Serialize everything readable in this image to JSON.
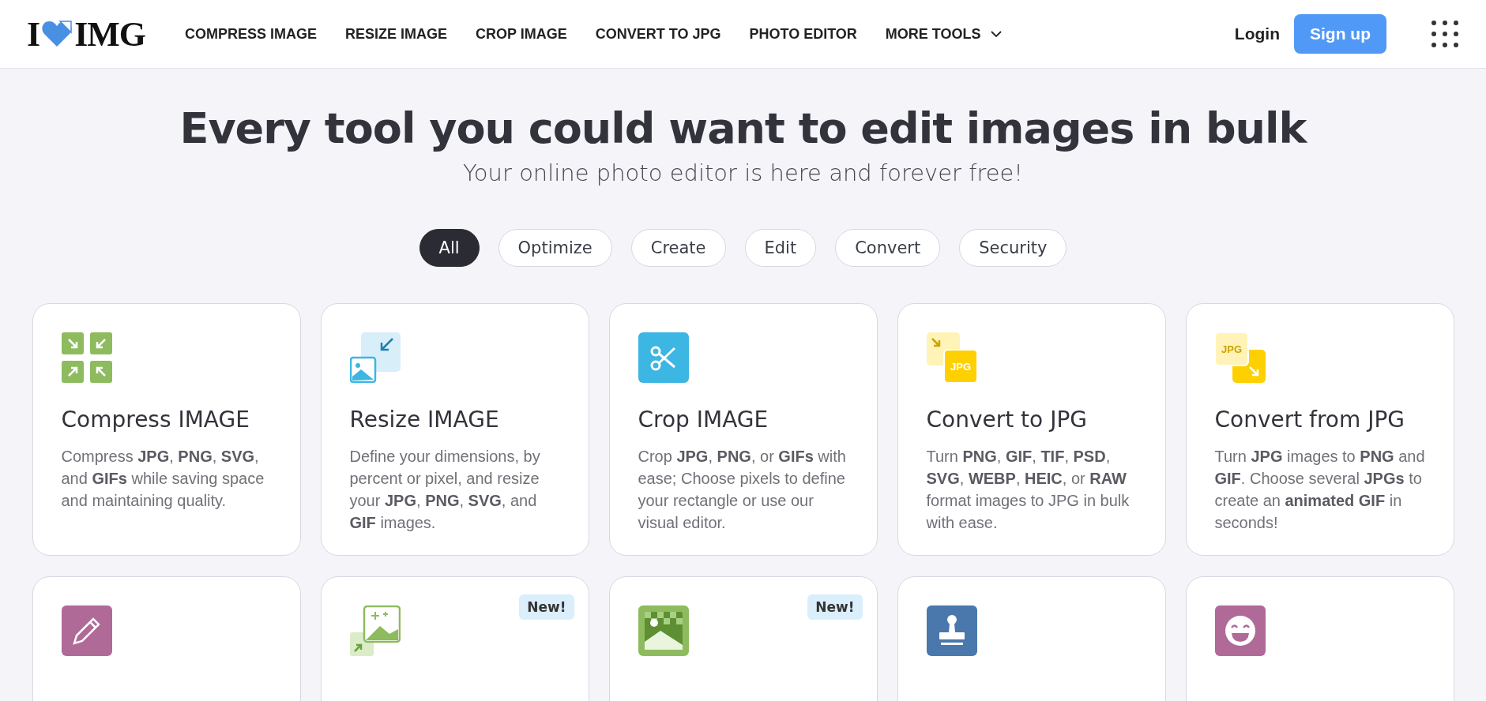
{
  "logo": {
    "left": "I",
    "right": "IMG"
  },
  "nav": [
    {
      "label": "COMPRESS IMAGE"
    },
    {
      "label": "RESIZE IMAGE"
    },
    {
      "label": "CROP IMAGE"
    },
    {
      "label": "CONVERT TO JPG"
    },
    {
      "label": "PHOTO EDITOR"
    },
    {
      "label": "MORE TOOLS",
      "dropdown": true
    }
  ],
  "login": "Login",
  "signup": "Sign up",
  "hero": {
    "title": "Every tool you could want to edit images in bulk",
    "subtitle": "Your online photo editor is here and forever free!"
  },
  "filters": [
    {
      "label": "All",
      "selected": true
    },
    {
      "label": "Optimize",
      "selected": false
    },
    {
      "label": "Create",
      "selected": false
    },
    {
      "label": "Edit",
      "selected": false
    },
    {
      "label": "Convert",
      "selected": false
    },
    {
      "label": "Security",
      "selected": false
    }
  ],
  "tools": [
    {
      "kind": "compress",
      "title": "Compress IMAGE",
      "description": "Compress **JPG**, **PNG**, **SVG**, and **GIFs** while saving space and maintaining quality."
    },
    {
      "kind": "resize",
      "title": "Resize IMAGE",
      "description": "Define your dimensions, by percent or pixel, and resize your **JPG**, **PNG**, **SVG**, and **GIF** images."
    },
    {
      "kind": "crop",
      "title": "Crop IMAGE",
      "description": "Crop **JPG**, **PNG**, or **GIFs** with ease; Choose pixels to define your rectangle or use our visual editor."
    },
    {
      "kind": "convert-to",
      "icon_text": "JPG",
      "title": "Convert to JPG",
      "description": "Turn **PNG**, **GIF**, **TIF**, **PSD**, **SVG**, **WEBP**, **HEIC**, or **RAW** format images to JPG in bulk with ease."
    },
    {
      "kind": "convert-from",
      "icon_text": "JPG",
      "title": "Convert from JPG",
      "description": "Turn **JPG** images to **PNG** and **GIF**. Choose several **JPGs** to create an **animated GIF** in seconds!"
    },
    {
      "kind": "edit"
    },
    {
      "kind": "upscale",
      "badge": "New!"
    },
    {
      "kind": "remove-bg",
      "badge": "New!"
    },
    {
      "kind": "watermark"
    },
    {
      "kind": "meme"
    }
  ]
}
